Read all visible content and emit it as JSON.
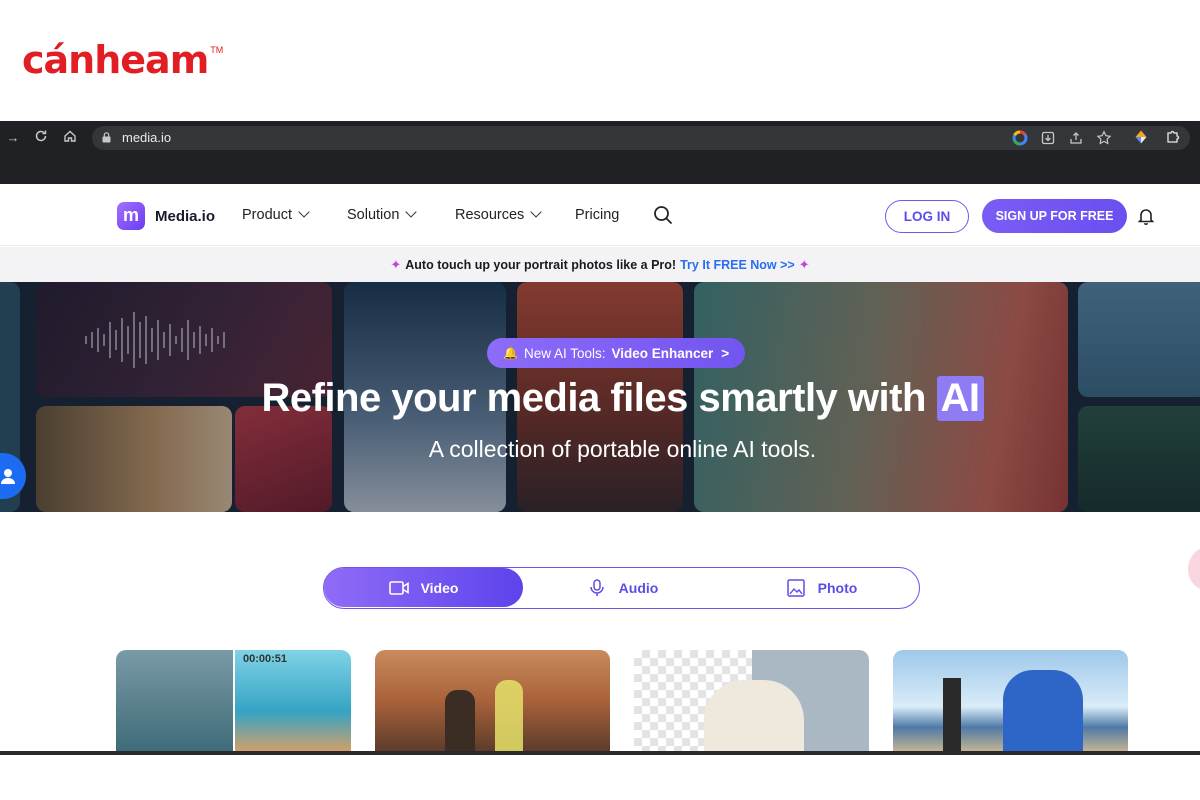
{
  "watermark": {
    "text": "cánheam",
    "tm": "TM"
  },
  "browser": {
    "url": "media.io",
    "icons": [
      "forward-icon",
      "reload-icon",
      "home-icon",
      "lock-icon",
      "google-icon",
      "download-icon",
      "share-icon",
      "star-icon",
      "extension-icon",
      "puzzle-icon"
    ]
  },
  "header": {
    "logo_mark": "m",
    "logo_text": "Media.io",
    "nav": [
      {
        "label": "Product",
        "has_dropdown": true
      },
      {
        "label": "Solution",
        "has_dropdown": true
      },
      {
        "label": "Resources",
        "has_dropdown": true
      },
      {
        "label": "Pricing",
        "has_dropdown": false
      }
    ],
    "login_label": "LOG IN",
    "signup_label": "SIGN UP FOR FREE",
    "accent_color": "#6b4ff0"
  },
  "promo": {
    "text": "Auto touch up your portrait photos like a Pro!",
    "link": "Try It FREE Now >>"
  },
  "hero": {
    "badge_prefix": "New AI Tools:",
    "badge_strong": "Video Enhancer",
    "badge_arrow": ">",
    "title_main": "Refine your media files smartly with",
    "title_ai": "AI",
    "subtitle": "A collection of portable online AI tools."
  },
  "tabs": [
    {
      "label": "Video",
      "active": true
    },
    {
      "label": "Audio",
      "active": false
    },
    {
      "label": "Photo",
      "active": false
    }
  ],
  "cards": [
    {
      "timecode": "00:00:51"
    },
    {
      "timecode": ""
    },
    {
      "timecode": ""
    },
    {
      "timecode": ""
    }
  ]
}
